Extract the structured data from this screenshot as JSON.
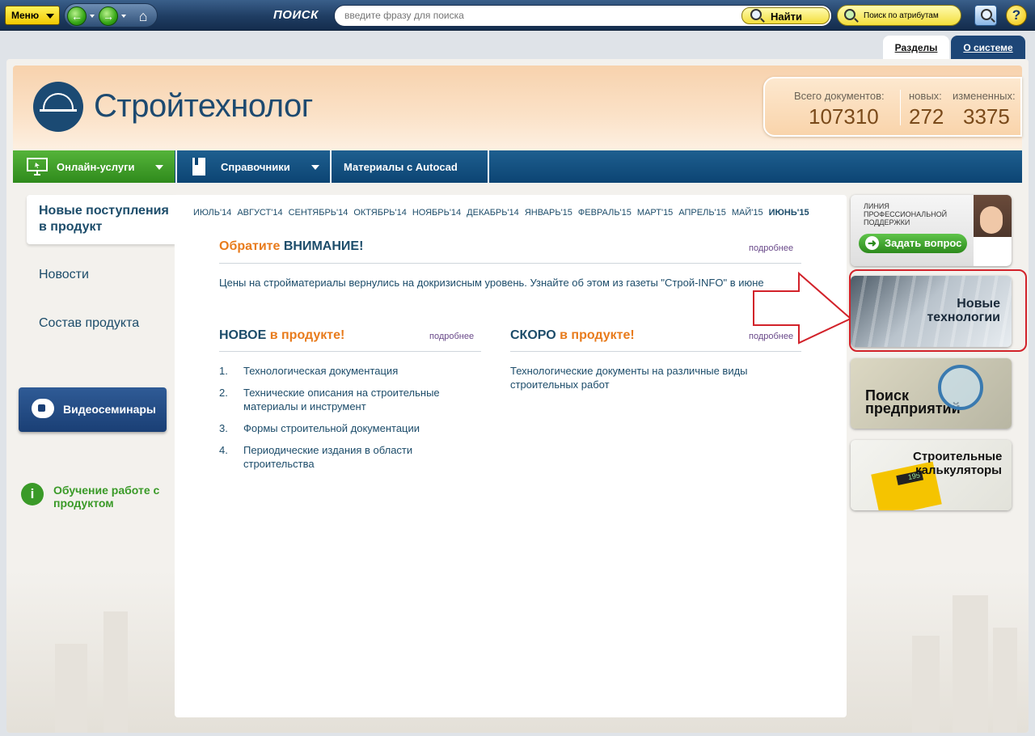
{
  "toolbar": {
    "menu_label": "Меню",
    "search_label": "ПОИСК",
    "search_placeholder": "введите фразу для поиска",
    "find_label": "Найти",
    "attr_search_label": "Поиск по атрибутам",
    "help_label": "?"
  },
  "tabs": {
    "sections": "Разделы",
    "about": "О системе"
  },
  "header": {
    "logo_text": "Стройтехнолог",
    "stats": {
      "total_label": "Всего документов:",
      "total_value": "107310",
      "new_label": "новых:",
      "new_value": "272",
      "changed_label": "измененных:",
      "changed_value": "3375"
    }
  },
  "nav": {
    "online": "Онлайн-услуги",
    "references": "Справочники",
    "autocad": "Материалы с Autocad"
  },
  "sidebar": {
    "active": "Новые поступления в продукт",
    "news": "Новости",
    "composition": "Состав продукта",
    "video": "Видеосеминары",
    "learn": "Обучение работе с продуктом"
  },
  "months": [
    "ИЮЛЬ'14",
    "АВГУСТ'14",
    "СЕНТЯБРЬ'14",
    "ОКТЯБРЬ'14",
    "НОЯБРЬ'14",
    "ДЕКАБРЬ'14",
    "ЯНВАРЬ'15",
    "ФЕВРАЛЬ'15",
    "МАРТ'15",
    "АПРЕЛЬ'15",
    "МАЙ'15",
    "ИЮНЬ'15"
  ],
  "attention": {
    "title_accent": "Обратите",
    "title_rest": "ВНИМАНИЕ!",
    "more": "подробнее",
    "text": "Цены на стройматериалы вернулись на докризисным уровень. Узнайте об этом из газеты \"Строй-INFO\" в июне"
  },
  "new_section": {
    "title_main": "НОВОЕ",
    "title_accent": "в продукте!",
    "more": "подробнее",
    "items": [
      "Технологическая документация",
      "Технические описания на строительные материалы и инструмент",
      "Формы строительной документации",
      "Периодические издания в области строительства"
    ]
  },
  "soon_section": {
    "title_main": "СКОРО",
    "title_accent": "в продукте!",
    "more": "подробнее",
    "text": "Технологические документы на различные виды строительных работ"
  },
  "banners": {
    "support_line": "ЛИНИЯ ПРОФЕССИОНАЛЬНОЙ ПОДДЕРЖКИ",
    "ask": "Задать вопрос",
    "tech": "Новые технологии",
    "search": "Поиск предприятий",
    "calc": "Строительные калькуляторы",
    "calc_display": "195"
  },
  "colors": {
    "accent_orange": "#e87b1c",
    "primary_blue": "#1c4c6a",
    "green": "#3a9a28",
    "highlight_red": "#d2222a"
  }
}
